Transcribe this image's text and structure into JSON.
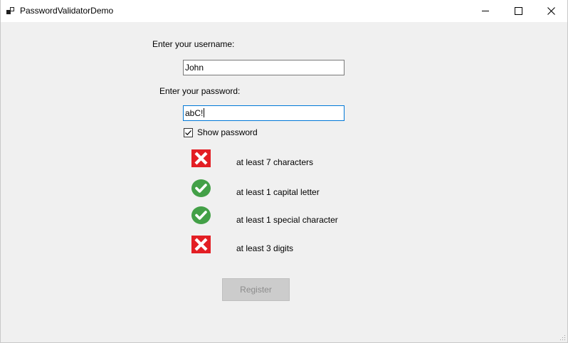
{
  "window": {
    "title": "PasswordValidatorDemo",
    "icons": {
      "app": "app-icon",
      "minimize": "minimize-icon",
      "maximize": "maximize-icon",
      "close": "close-icon"
    }
  },
  "form": {
    "username_label": "Enter your username:",
    "username_value": "John",
    "password_label": "Enter your password:",
    "password_value": "abC!",
    "show_password_label": "Show password",
    "show_password_checked": true,
    "register_label": "Register",
    "register_enabled": false
  },
  "rules": [
    {
      "label": "at least 7 characters",
      "status": "fail",
      "icon": "fail-cross-icon"
    },
    {
      "label": "at least 1 capital letter",
      "status": "pass",
      "icon": "pass-check-icon"
    },
    {
      "label": "at least 1 special character",
      "status": "pass",
      "icon": "pass-check-icon"
    },
    {
      "label": "at least 3 digits",
      "status": "fail",
      "icon": "fail-cross-icon"
    }
  ],
  "colors": {
    "fail": "#e31e24",
    "pass": "#43a047",
    "focus_border": "#0078d7",
    "disabled_button": "#cccccc",
    "disabled_text": "#8c8c8c"
  }
}
